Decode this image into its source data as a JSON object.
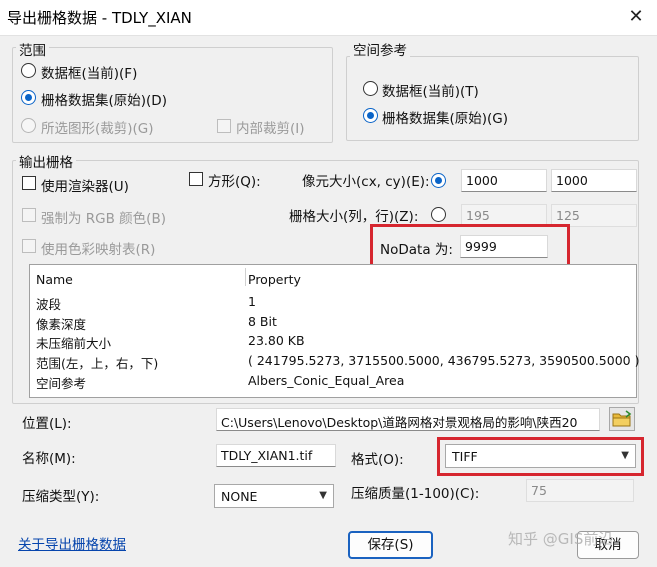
{
  "window": {
    "title": "导出栅格数据 - TDLY_XIAN",
    "close_glyph": "✕"
  },
  "extent": {
    "legend": "范围",
    "options": [
      {
        "label": "数据框(当前)(F)",
        "selected": false,
        "enabled": true
      },
      {
        "label": "栅格数据集(原始)(D)",
        "selected": true,
        "enabled": true
      },
      {
        "label": "所选图形(裁剪)(G)",
        "selected": false,
        "enabled": false
      }
    ],
    "clip_inside": {
      "label": "内部裁剪(I)",
      "checked": false,
      "enabled": false
    }
  },
  "spatial_ref": {
    "legend": "空间参考",
    "options": [
      {
        "label": "数据框(当前)(T)",
        "selected": false
      },
      {
        "label": "栅格数据集(原始)(G)",
        "selected": true
      }
    ]
  },
  "output": {
    "legend": "输出栅格",
    "use_renderer": "使用渲染器(U)",
    "force_rgb": "强制为 RGB 颜色(B)",
    "use_colormap": "使用色彩映射表(R)",
    "square": "方形(Q):",
    "cell_size_label": "像元大小(cx, cy)(E):",
    "cell_size_x": "1000",
    "cell_size_y": "1000",
    "raster_size_label": "栅格大小(列，行)(Z):",
    "raster_cols": "195",
    "raster_rows": "125",
    "nodata_label": "NoData 为:",
    "nodata_value": "9999"
  },
  "properties": {
    "headers": [
      "Name",
      "Property"
    ],
    "rows": [
      {
        "name": "波段",
        "value": "1"
      },
      {
        "name": "像素深度",
        "value": "8 Bit"
      },
      {
        "name": "未压缩前大小",
        "value": "23.80 KB"
      },
      {
        "name": "范围(左，上，右，下)",
        "value": "( 241795.5273, 3715500.5000, 436795.5273, 3590500.5000 )"
      },
      {
        "name": "空间参考",
        "value": "Albers_Conic_Equal_Area"
      }
    ]
  },
  "location": {
    "label": "位置(L):",
    "value": "C:\\Users\\Lenovo\\Desktop\\道路网格对景观格局的影响\\陕西20"
  },
  "name": {
    "label": "名称(M):",
    "value": "TDLY_XIAN1.tif"
  },
  "format": {
    "label": "格式(O):",
    "value": "TIFF"
  },
  "compression": {
    "label": "压缩类型(Y):",
    "value": "NONE"
  },
  "quality": {
    "label": "压缩质量(1-100)(C):",
    "value": "75"
  },
  "footer": {
    "about_link": "关于导出栅格数据",
    "save": "保存(S)",
    "cancel": "取消",
    "watermark": "知乎 @GIS前沿"
  },
  "colors": {
    "accent": "#0a64c8",
    "highlight": "#d6262f",
    "link": "#0645ad"
  }
}
